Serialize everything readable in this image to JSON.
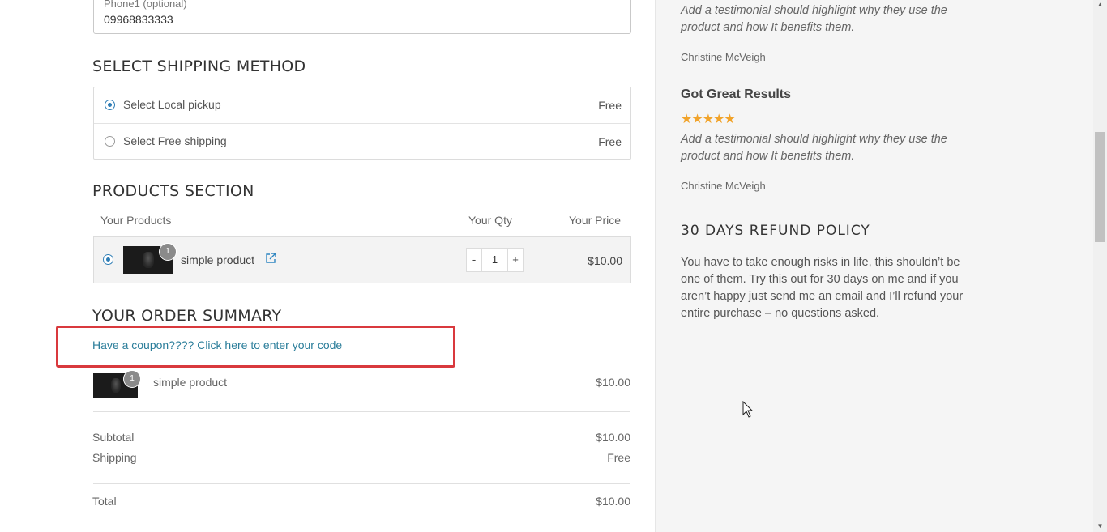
{
  "phone": {
    "label": "Phone1 (optional)",
    "value": "09968833333"
  },
  "shipping": {
    "title": "SELECT SHIPPING METHOD",
    "options": [
      {
        "label": "Select Local pickup",
        "price": "Free",
        "selected": true
      },
      {
        "label": "Select Free shipping",
        "price": "Free",
        "selected": false
      }
    ]
  },
  "products": {
    "title": "PRODUCTS SECTION",
    "headers": {
      "product": "Your Products",
      "qty": "Your Qty",
      "price": "Your Price"
    },
    "items": [
      {
        "name": "simple product",
        "badge": "1",
        "qty": "1",
        "minus": "-",
        "plus": "+",
        "price": "$10.00",
        "selected": true
      }
    ]
  },
  "summary": {
    "title": "YOUR ORDER SUMMARY",
    "coupon_link": "Have a coupon???? Click here to enter your code",
    "items": [
      {
        "name": "simple product",
        "badge": "1",
        "price": "$10.00"
      }
    ],
    "subtotal_label": "Subtotal",
    "subtotal": "$10.00",
    "shipping_label": "Shipping",
    "shipping": "Free",
    "total_label": "Total",
    "total": "$10.00"
  },
  "sidebar": {
    "testimonials": [
      {
        "text": "Add a testimonial should highlight why they use the product and how It benefits them.",
        "author": "Christine McVeigh"
      },
      {
        "title": "Got Great Results",
        "stars": 5,
        "stars_text": "★★★★★",
        "text": "Add a testimonial should highlight why they use the product and how It benefits them.",
        "author": "Christine McVeigh"
      }
    ],
    "refund": {
      "title": "30 DAYS REFUND POLICY",
      "text": "You have to take enough risks in life, this shouldn’t be one of them. Try this out for 30 days on me and if you aren’t happy just send me an email and I’ll refund your entire purchase – no questions asked."
    }
  },
  "colors": {
    "accent": "#2a7d9a",
    "highlight_border": "#d9393d",
    "stars": "#f1a32a",
    "sidebar_bg": "#f5f5f5"
  },
  "icons": {
    "external_link": "external-link-icon",
    "radio": "radio-icon",
    "cursor": "mouse-cursor-icon"
  }
}
